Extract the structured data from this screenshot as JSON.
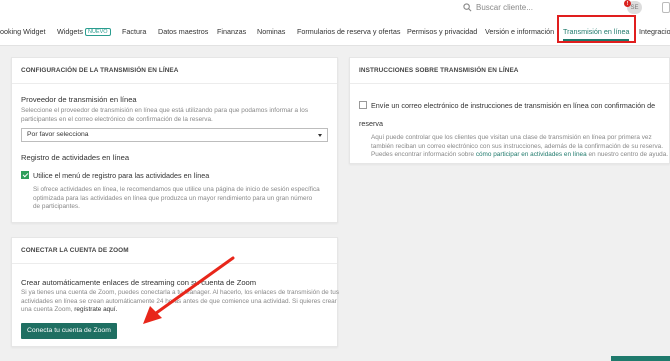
{
  "topbar": {
    "search_placeholder": "Buscar cliente...",
    "avatar_initials": "SE",
    "notification_count": "!"
  },
  "nav": {
    "tabs": [
      {
        "label": "ooking Widget"
      },
      {
        "label": "Widgets",
        "badge": "NUEVO"
      },
      {
        "label": "Factura"
      },
      {
        "label": "Datos maestros"
      },
      {
        "label": "Finanzas"
      },
      {
        "label": "Nominas"
      },
      {
        "label": "Formularios de reserva y ofertas"
      },
      {
        "label": "Permisos y privacidad"
      },
      {
        "label": "Versión e información"
      },
      {
        "label": "Transmisión en línea"
      },
      {
        "label": "Integracio"
      }
    ],
    "active_tab": "Transmisión en línea"
  },
  "config_card": {
    "heading": "CONFIGURACIÓN DE LA TRANSMISIÓN EN LÍNEA",
    "provider_title": "Proveedor de transmisión en línea",
    "provider_desc": "Seleccione el proveedor de transmisión en línea que está utilizando para que podamos informar a los participantes en el correo electrónico de confirmación de la reserva.",
    "provider_select_value": "Por favor selecciona",
    "log_title": "Registro de actividades en línea",
    "log_checkbox_label": "Utilice el menú de registro para las actividades en línea",
    "log_checkbox_checked": true,
    "log_desc": "Si ofrece actividades en línea, le recomendamos que utilice una página de inicio de sesión específica optimizada para las actividades en línea que produzca un mayor rendimiento para un gran número de participantes."
  },
  "zoom_card": {
    "heading": "CONECTAR LA CUENTA DE ZOOM",
    "title": "Crear automáticamente enlaces de streaming con su cuenta de Zoom",
    "desc_line1": "Si ya tienes una cuenta de Zoom, puedes conectarla a tu Manager. Al hacerlo, los enlaces de transmisión de tus",
    "desc_line2": "actividades en línea se crean automáticamente 24 horas antes de que comience una actividad. Si quieres crear",
    "desc_line3_prefix": "una cuenta Zoom,",
    "desc_link": "regístrate aquí.",
    "button_label": "Conecta tu cuenta de Zoom"
  },
  "instructions_card": {
    "heading": "INSTRUCCIONES SOBRE TRANSMISIÓN EN LÍNEA",
    "checkbox_label": "Envíe un correo electrónico de instrucciones de transmisión en línea con confirmación de reserva",
    "checkbox_checked": false,
    "desc_prefix": "Aquí puede controlar que los clientes que visitan una clase de transmisión en línea por primera vez también reciban un correo electrónico con sus instrucciones, además de la confirmación de su reserva. Puedes encontrar información sobre",
    "desc_link": "cómo participar en actividades en línea",
    "desc_suffix": "en nuestro centro de ayuda."
  },
  "colors": {
    "accent": "#1f7a6c",
    "highlight": "#e01e1e",
    "checkbox_green": "#2e9e5a"
  }
}
